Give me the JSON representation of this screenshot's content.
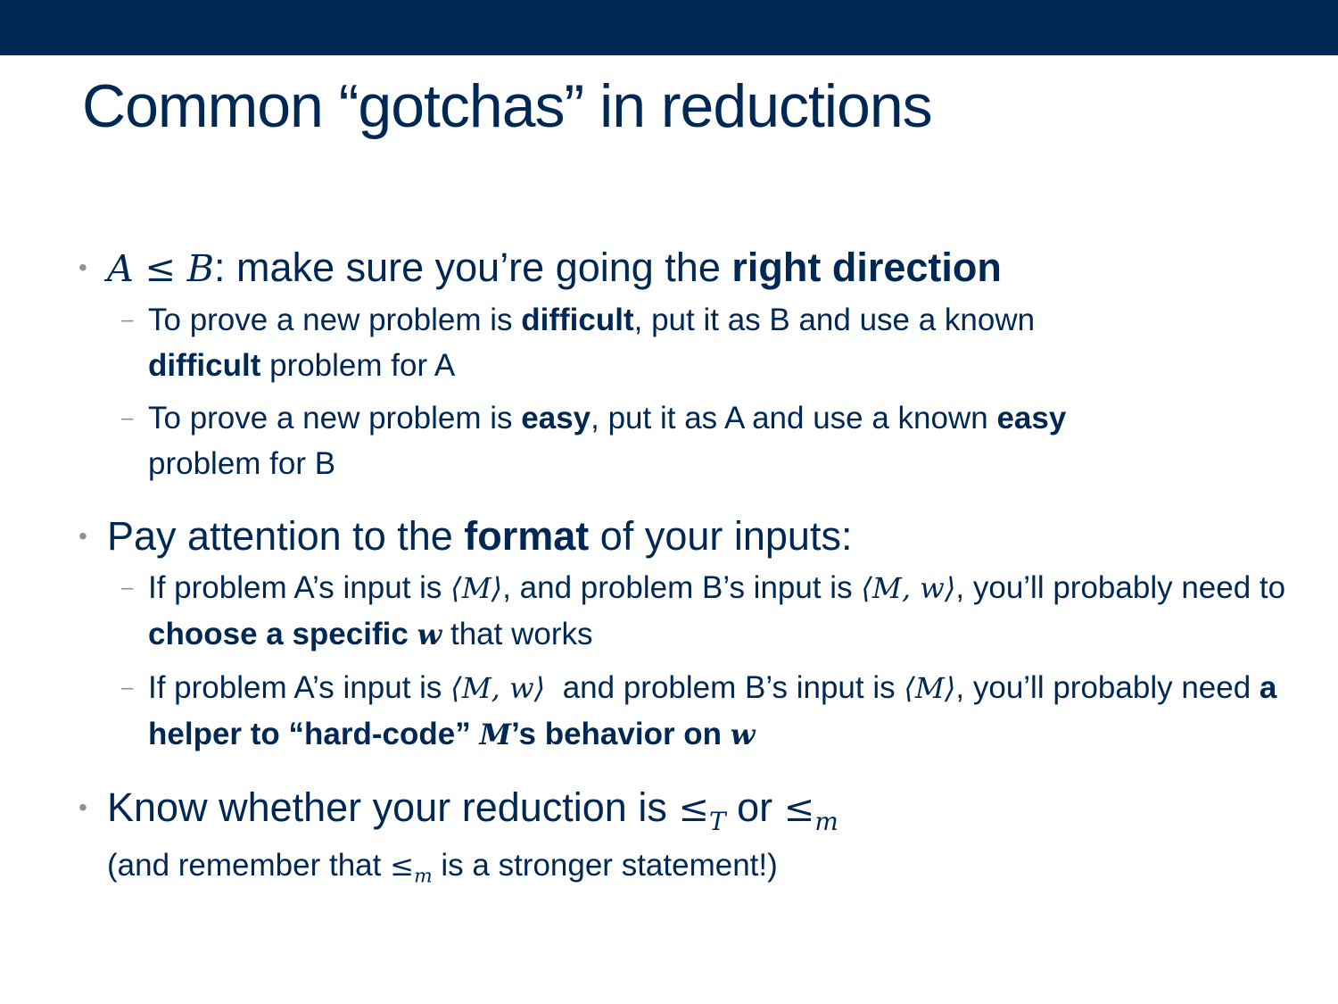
{
  "slide": {
    "title": "Common “gotchas” in reductions"
  },
  "bullet1": {
    "math_a": "A",
    "math_leq": "≤",
    "math_b": "B",
    "text": ": make sure you’re going the ",
    "bold": "right direction"
  },
  "bullet1_sub1": {
    "t1": "To prove a new problem is ",
    "b1": "difficult",
    "t2": ", put it as B and use a known ",
    "b2": "difficult",
    "t3": " problem for A"
  },
  "bullet1_sub2": {
    "t1": "To prove a new problem is ",
    "b1": "easy",
    "t2": ", put it as A and use a known ",
    "b2": "easy",
    "t3": " problem for B"
  },
  "bullet2": {
    "t1": "Pay attention to the ",
    "b1": "format",
    "t2": " of your inputs:"
  },
  "bullet2_sub1": {
    "t1": "If problem A’s input is ",
    "m1": "⟨M⟩",
    "t2": ", and problem B’s input is ",
    "m2": "⟨M, w⟩",
    "t3": ", you’ll probably need to ",
    "b1": "choose a specific ",
    "mb1": "w",
    "t4": " that works"
  },
  "bullet2_sub2": {
    "t1": "If problem A’s input is ",
    "m1": "⟨M, w⟩",
    "t2": "  and problem B’s input is ",
    "m2": "⟨M⟩",
    "t3": ", you’ll probably need ",
    "b1": "a helper to “hard-code” ",
    "mb1": "M",
    "b2": "’s behavior on ",
    "mb2": "w"
  },
  "bullet3": {
    "t1": "Know whether your reduction is ",
    "leq1": "≤",
    "sub1": "T",
    "t2": " or ",
    "leq2": "≤",
    "sub2": "m",
    "note_t1": "(and remember that ",
    "note_leq": "≤",
    "note_sub": "m",
    "note_t2": " is a stronger statement!)"
  },
  "colors": {
    "navy": "#002855",
    "bullet_gray": "#8a9199",
    "background": "#ffffff"
  }
}
